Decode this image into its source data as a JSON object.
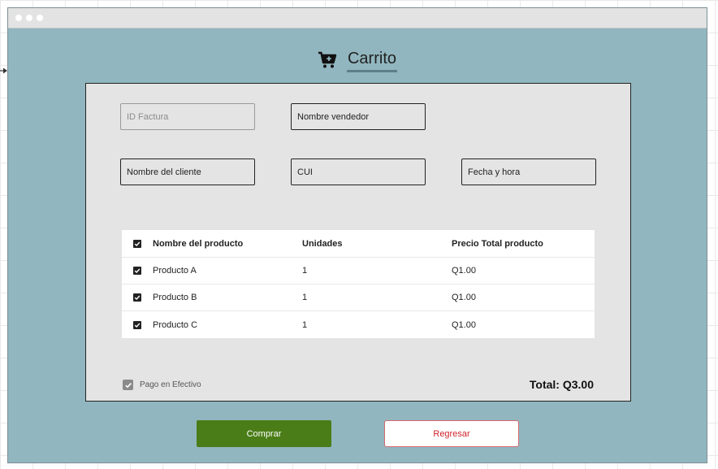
{
  "header": {
    "title": "Carrito",
    "icon": "cart-plus-icon"
  },
  "form": {
    "invoice_id": {
      "placeholder": "ID Factura",
      "disabled": true
    },
    "seller_name": {
      "placeholder": "Nombre vendedor"
    },
    "client_name": {
      "placeholder": "Nombre del cliente"
    },
    "cui": {
      "placeholder": "CUI"
    },
    "datetime": {
      "placeholder": "Fecha y hora"
    }
  },
  "table": {
    "columns": [
      "Nombre del producto",
      "Unidades",
      "Precio Total producto"
    ],
    "rows": [
      {
        "checked": true,
        "name": "Producto A",
        "units": "1",
        "price": "Q1.00"
      },
      {
        "checked": true,
        "name": "Producto B",
        "units": "1",
        "price": "Q1.00"
      },
      {
        "checked": true,
        "name": "Producto C",
        "units": "1",
        "price": "Q1.00"
      }
    ]
  },
  "payment": {
    "cash_label": "Pago en Efectivo",
    "cash_checked": true
  },
  "total": "Total: Q3.00",
  "actions": {
    "buy_label": "Comprar",
    "back_label": "Regresar"
  },
  "colors": {
    "window_bg": "#91b6bf",
    "buy_button": "#4a7d17",
    "back_text": "#d0232a"
  }
}
